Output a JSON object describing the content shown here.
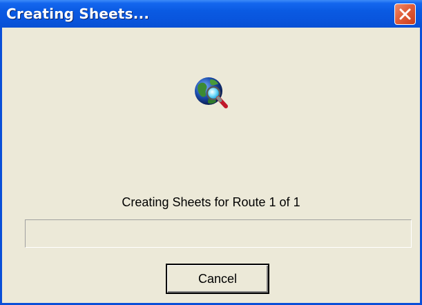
{
  "window": {
    "title": "Creating Sheets..."
  },
  "icons": {
    "title_close": "close-icon",
    "main": "globe-search-icon"
  },
  "status": {
    "message": "Creating Sheets for Route 1 of 1"
  },
  "progress": {
    "value": 0
  },
  "buttons": {
    "cancel_label": "Cancel"
  },
  "colors": {
    "titlebar": "#0a5ae2",
    "window_bg": "#ece9d8",
    "close_button": "#e15f3b",
    "progress_fill": "#2fb32f"
  }
}
